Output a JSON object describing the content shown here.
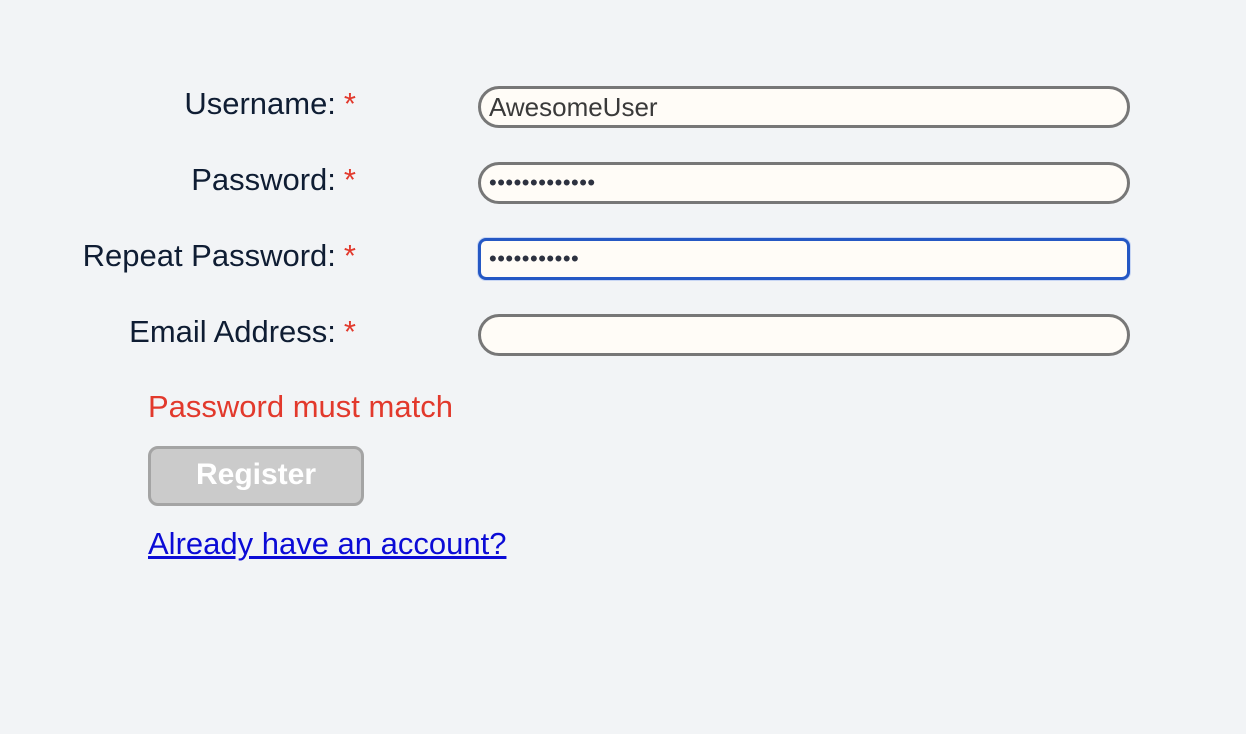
{
  "form": {
    "fields": [
      {
        "label": "Username:",
        "required_mark": "*",
        "value": "AwesomeUser",
        "type": "text"
      },
      {
        "label": "Password:",
        "required_mark": "*",
        "value": "•••••••••••••",
        "type": "password"
      },
      {
        "label": "Repeat Password:",
        "required_mark": "*",
        "value": "•••••••••••",
        "type": "password",
        "focused": true
      },
      {
        "label": "Email Address:",
        "required_mark": "*",
        "value": "",
        "type": "email"
      }
    ],
    "error_message": "Password must match",
    "register_label": "Register",
    "register_disabled": true,
    "login_link": "Already have an account?"
  },
  "colors": {
    "background": "#f2f4f6",
    "required": "#e2392c",
    "error": "#e2392c",
    "focus_border": "#2558c4",
    "link": "#0b0bd6",
    "button_disabled": "#cbcbcb"
  }
}
